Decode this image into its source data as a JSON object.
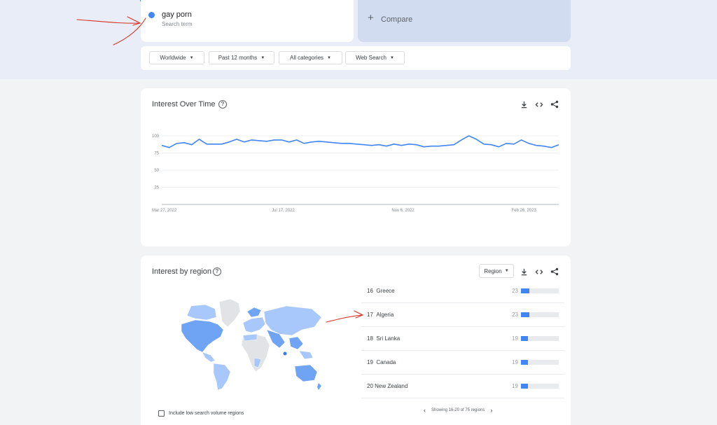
{
  "search_term": {
    "name": "gay porn",
    "sublabel": "Search term",
    "color": "#4285f4"
  },
  "compare": {
    "plus": "+",
    "label": "Compare"
  },
  "filters": [
    {
      "label": "Worldwide"
    },
    {
      "label": "Past 12 months"
    },
    {
      "label": "All categories"
    },
    {
      "label": "Web Search"
    }
  ],
  "interest_over_time": {
    "title": "Interest Over Time",
    "help": "?",
    "tools": [
      "download-icon",
      "embed-icon",
      "share-icon"
    ]
  },
  "chart_data": {
    "type": "line",
    "title": "Interest Over Time",
    "xlabel": "",
    "ylabel": "",
    "ylim": [
      0,
      100
    ],
    "yticks": [
      100,
      75,
      50,
      25
    ],
    "xtick_labels": [
      "Mar 27, 2022",
      "Jul 17, 2022",
      "Nov 6, 2022",
      "Feb 26, 2023"
    ],
    "xtick_index": [
      0,
      16,
      32,
      48
    ],
    "grid": true,
    "series": [
      {
        "color": "#4285f4",
        "values": [
          86,
          83,
          89,
          90,
          87,
          95,
          88,
          88,
          88,
          91,
          95,
          91,
          94,
          93,
          92,
          94,
          94,
          91,
          94,
          89,
          91,
          92,
          91,
          90,
          89,
          89,
          88,
          87,
          86,
          87,
          85,
          88,
          86,
          88,
          87,
          84,
          85,
          85,
          86,
          87,
          94,
          100,
          95,
          88,
          87,
          84,
          89,
          88,
          94,
          89,
          86,
          85,
          83,
          87
        ]
      }
    ]
  },
  "interest_by_region": {
    "title": "Interest by region",
    "help": "?",
    "resolution": "Region",
    "tools": [
      "download-icon",
      "embed-icon",
      "share-icon"
    ],
    "rows": [
      {
        "rank": "16",
        "name": "Greece",
        "value": 23
      },
      {
        "rank": "17",
        "name": "Algeria",
        "value": 23
      },
      {
        "rank": "18",
        "name": "Sri Lanka",
        "value": 19
      },
      {
        "rank": "19",
        "name": "Canada",
        "value": 19
      },
      {
        "rank": "20",
        "name": "New Zealand",
        "value": 19
      }
    ],
    "pager_text": "Showing 16-20 of 75 regions",
    "low_volume_label": "Include low search volume regions"
  },
  "colors": {
    "accent": "#4285f4",
    "annotation": "#d93025",
    "map_light": "#a8c7fa",
    "map_mid": "#6fa3f3",
    "map_dark": "#3b7ce8",
    "map_none": "#e1e3e6"
  }
}
